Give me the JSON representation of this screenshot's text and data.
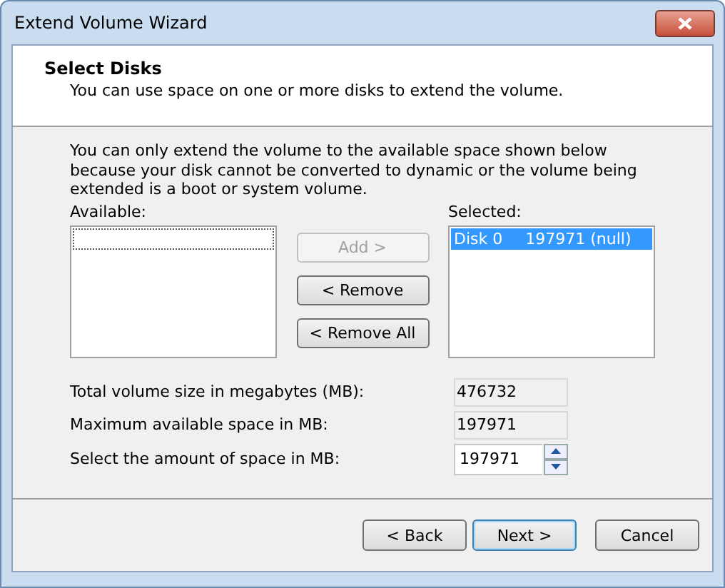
{
  "window": {
    "title": "Extend Volume Wizard"
  },
  "header": {
    "title": "Select Disks",
    "subtitle": "You can use space on one or more disks to extend the volume."
  },
  "note": "You can only extend the volume to the available space shown below because your disk cannot be converted to dynamic or the volume being extended is a boot or system volume.",
  "available": {
    "label": "Available:"
  },
  "transfer_buttons": [
    {
      "label": "Add >",
      "disabled": true
    },
    {
      "label": "< Remove",
      "disabled": false
    },
    {
      "label": "< Remove All",
      "disabled": false
    }
  ],
  "selected": {
    "label": "Selected:",
    "items": [
      {
        "disk": "Disk 0",
        "size": "197971 (null)",
        "selected": true
      }
    ]
  },
  "fields": [
    {
      "kind": "readonly",
      "label": "Total volume size in megabytes (MB):",
      "value": "476732"
    },
    {
      "kind": "readonly",
      "label": "Maximum available space in MB:",
      "value": "197971"
    },
    {
      "kind": "spin",
      "label": "Select the amount of space in MB:",
      "value": "197971"
    }
  ],
  "buttons": [
    {
      "label": "< Back",
      "default": false
    },
    {
      "label": "Next >",
      "default": true
    },
    {
      "label": "Cancel",
      "default": false
    }
  ]
}
